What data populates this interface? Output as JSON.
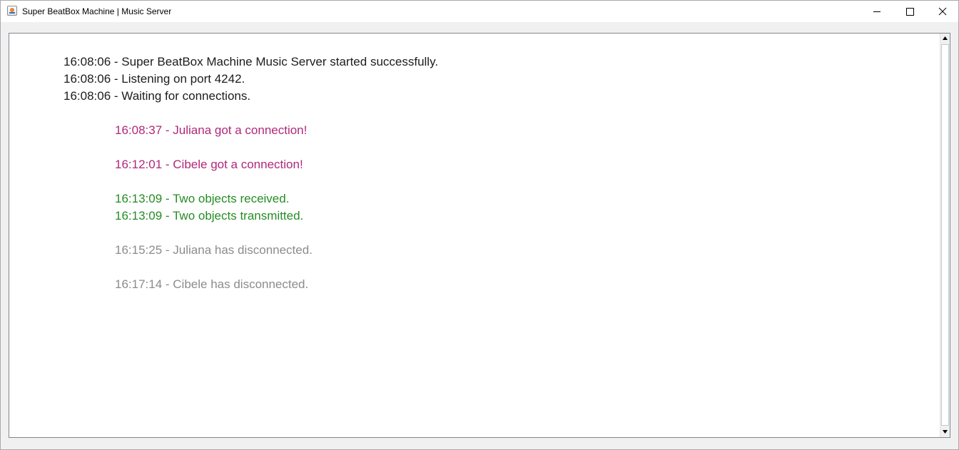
{
  "window": {
    "title": "Super BeatBox Machine | Music Server"
  },
  "colors": {
    "system": "#1c1c1c",
    "connection": "#b0287a",
    "transfer": "#268c26",
    "disconnect": "#8c8c8c"
  },
  "log": [
    {
      "text": "16:08:06 - Super BeatBox Machine Music Server started successfully.",
      "kind": "system"
    },
    {
      "text": "16:08:06 - Listening on port 4242.",
      "kind": "system"
    },
    {
      "text": "16:08:06 - Waiting for connections.",
      "kind": "system"
    },
    {
      "text": "16:08:37 - Juliana got a connection!",
      "kind": "connection"
    },
    {
      "text": "16:12:01 - Cibele got a connection!",
      "kind": "connection"
    },
    {
      "text": "16:13:09 - Two objects received.",
      "kind": "transfer"
    },
    {
      "text": "16:13:09 - Two objects transmitted.",
      "kind": "transfer"
    },
    {
      "text": "16:15:25 - Juliana has disconnected.",
      "kind": "disconnect"
    },
    {
      "text": "16:17:14 - Cibele has disconnected.",
      "kind": "disconnect"
    }
  ],
  "icons": {
    "app": "java-app-icon",
    "minimize": "minimize-icon",
    "maximize": "maximize-icon",
    "close": "close-icon",
    "scroll_up": "scroll-up-arrow-icon",
    "scroll_down": "scroll-down-arrow-icon"
  }
}
